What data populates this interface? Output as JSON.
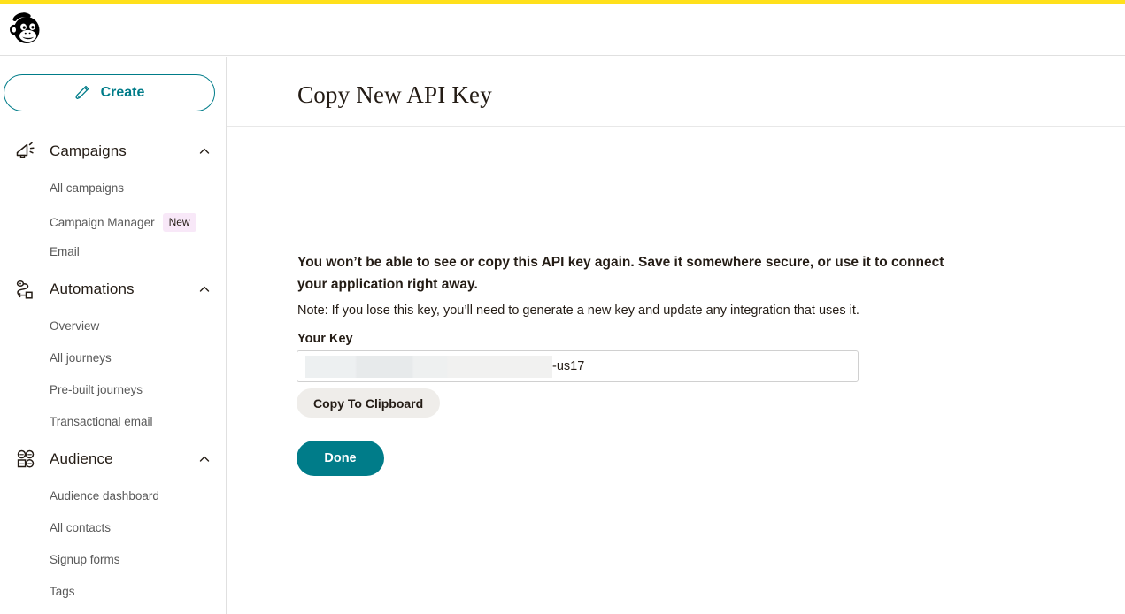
{
  "theme": {
    "accent_bar_color": "#ffe01b",
    "brand_teal": "#007c89",
    "badge_bg": "#f8e8f8",
    "button_secondary_bg": "#efedea",
    "text_primary": "#241c15",
    "text_muted": "#595959"
  },
  "header": {
    "logo_name": "mailchimp-freddie-logo"
  },
  "sidebar": {
    "create": {
      "label": "Create",
      "icon": "pencil-icon"
    },
    "sections": [
      {
        "id": "campaigns",
        "label": "Campaigns",
        "icon": "megaphone-icon",
        "chevron": "chevron-up-icon",
        "expanded": true,
        "items": [
          {
            "label": "All campaigns"
          },
          {
            "label": "Campaign Manager",
            "badge": "New"
          },
          {
            "label": "Email"
          }
        ]
      },
      {
        "id": "automations",
        "label": "Automations",
        "icon": "journey-path-icon",
        "chevron": "chevron-up-icon",
        "expanded": true,
        "items": [
          {
            "label": "Overview"
          },
          {
            "label": "All journeys"
          },
          {
            "label": "Pre-built journeys"
          },
          {
            "label": "Transactional email"
          }
        ]
      },
      {
        "id": "audience",
        "label": "Audience",
        "icon": "audience-group-icon",
        "chevron": "chevron-up-icon",
        "expanded": true,
        "items": [
          {
            "label": "Audience dashboard"
          },
          {
            "label": "All contacts"
          },
          {
            "label": "Signup forms"
          },
          {
            "label": "Tags"
          }
        ]
      }
    ]
  },
  "main": {
    "page_title": "Copy New API Key",
    "warning_text": "You won’t be able to see or copy this API key again. Save it somewhere secure, or use it to connect your application right away.",
    "note_text": "Note: If you lose this key, you’ll need to generate a new key and update any integration that uses it.",
    "key_field": {
      "label": "Your Key",
      "redacted": true,
      "visible_suffix": "-us17"
    },
    "copy_button_label": "Copy To Clipboard",
    "done_button_label": "Done"
  }
}
